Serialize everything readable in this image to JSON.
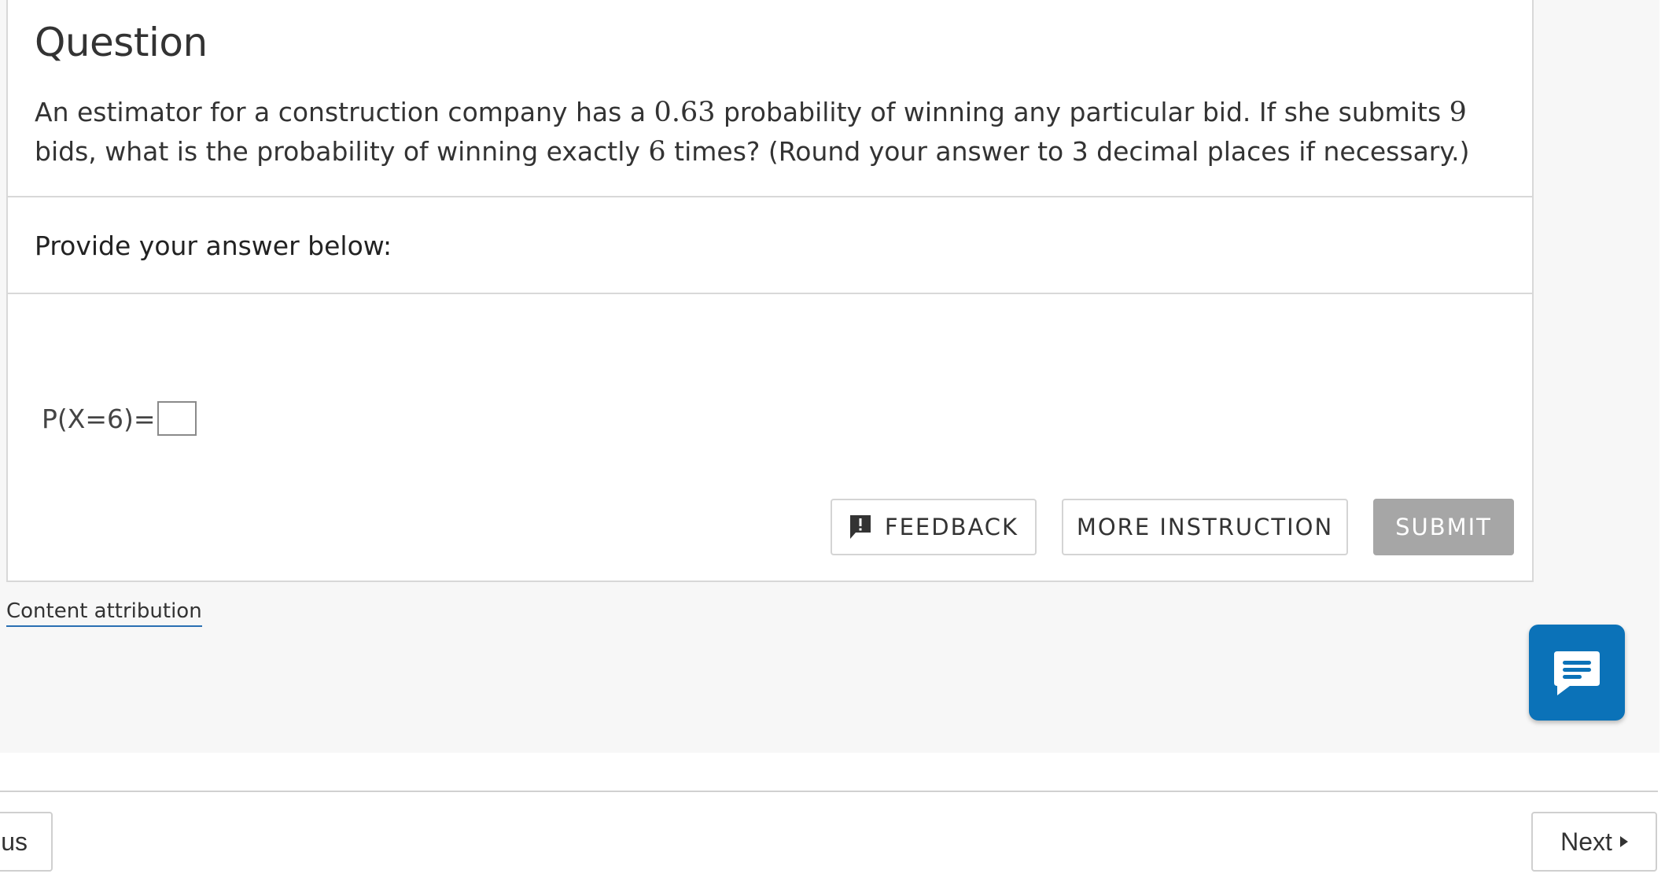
{
  "question": {
    "heading": "Question",
    "text_1": "An estimator for a construction company has a ",
    "num_prob": "0.63",
    "text_2": " probability of winning any particular bid. If she submits ",
    "num_bids": "9",
    "text_3": " bids, what is the probability of winning exactly ",
    "num_wins": "6",
    "text_4": " times? (Round your answer to 3 decimal places if necessary.)"
  },
  "answer": {
    "prompt": "Provide your answer below:",
    "label": "P(X=6)=",
    "value": ""
  },
  "buttons": {
    "feedback": "FEEDBACK",
    "more_instruction": "MORE INSTRUCTION",
    "submit": "SUBMIT"
  },
  "footer": {
    "attribution": "Content attribution",
    "previous": "us",
    "next": "Next"
  },
  "icons": {
    "feedback": "feedback-icon",
    "chat": "chat-icon",
    "next_arrow": "triangle-right-icon"
  },
  "colors": {
    "accent_blue": "#0b72b8",
    "submit_disabled": "#a6a6a6",
    "link_underline": "#2a6fb3"
  }
}
